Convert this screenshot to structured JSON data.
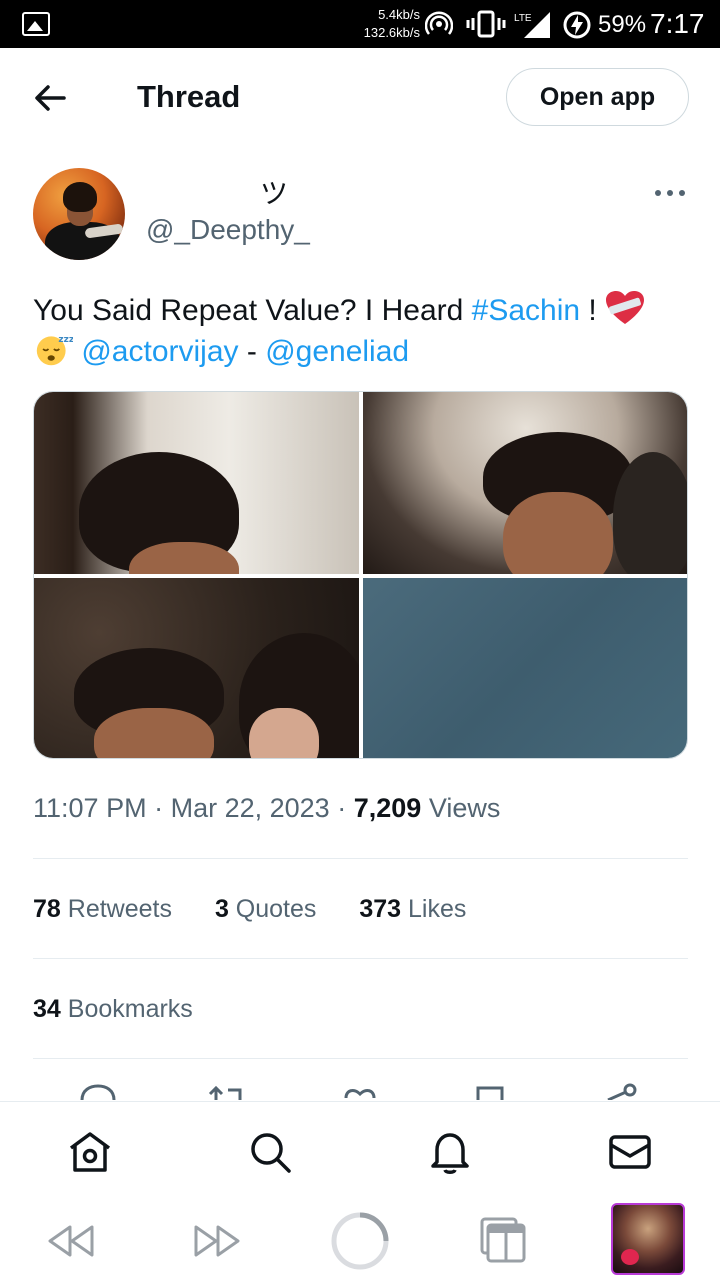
{
  "status_bar": {
    "speed_up": "5.4kb/s",
    "speed_down": "132.6kb/s",
    "network": "LTE",
    "battery": "59%",
    "time": "7:17",
    "icons": [
      "image-icon",
      "hotspot-icon",
      "vibrate-icon",
      "signal-icon",
      "battery-charging-icon"
    ]
  },
  "header": {
    "title": "Thread",
    "open_app_label": "Open app",
    "back_icon": "arrow-left-icon"
  },
  "tweet": {
    "display_name": "ツ",
    "handle": "@_Deepthy_",
    "text_parts": {
      "t1": "You Said Repeat Value? I Heard ",
      "hashtag": "#Sachin",
      "t2": " ! ",
      "mention1": "@actorvijay",
      "sep": " - ",
      "mention2": "@geneliad"
    },
    "emojis": [
      "mending-heart-emoji",
      "sleeping-face-emoji"
    ],
    "media_count": 4,
    "time": "11:07 PM",
    "date": "Mar 22, 2023",
    "views_count": "7,209",
    "views_label": "Views",
    "retweets_count": "78",
    "retweets_label": "Retweets",
    "quotes_count": "3",
    "quotes_label": "Quotes",
    "likes_count": "373",
    "likes_label": "Likes",
    "bookmarks_count": "34",
    "bookmarks_label": "Bookmarks"
  },
  "bottom_nav": {
    "items": [
      "home-icon",
      "search-icon",
      "notifications-icon",
      "messages-icon"
    ]
  },
  "browser_bar": {
    "items": [
      "rewind-icon",
      "fast-forward-icon",
      "loading-icon",
      "tabs-icon"
    ]
  },
  "colors": {
    "accent": "#1d9bf0",
    "text": "#0f1419",
    "secondary": "#536471",
    "border": "#cfd9de"
  }
}
